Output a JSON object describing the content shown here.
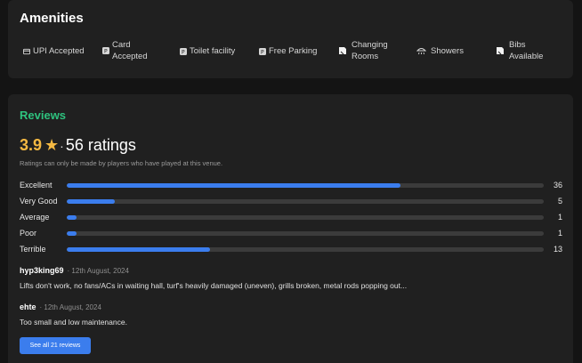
{
  "amenities": {
    "title": "Amenities",
    "items": [
      {
        "label_line1": "UPI Accepted",
        "label_line2": "",
        "icon": "upi-icon"
      },
      {
        "label_line1": "Card",
        "label_line2": "Accepted",
        "icon": "card-icon"
      },
      {
        "label_line1": "Toilet facility",
        "label_line2": "",
        "icon": "toilet-icon"
      },
      {
        "label_line1": "Free Parking",
        "label_line2": "",
        "icon": "parking-icon"
      },
      {
        "label_line1": "Changing",
        "label_line2": "Rooms",
        "icon": "changing-room-icon"
      },
      {
        "label_line1": "Showers",
        "label_line2": "",
        "icon": "shower-icon"
      },
      {
        "label_line1": "Bibs",
        "label_line2": "Available",
        "icon": "bibs-icon"
      }
    ]
  },
  "reviews": {
    "title": "Reviews",
    "score": "3.9",
    "star": "★",
    "separator": "·",
    "count_text": "56 ratings",
    "note": "Ratings can only be made by players who have played at this venue.",
    "distribution": [
      {
        "label": "Excellent",
        "count": "36",
        "fraction": 0.7
      },
      {
        "label": "Very Good",
        "count": "5",
        "fraction": 0.1
      },
      {
        "label": "Average",
        "count": "1",
        "fraction": 0.02
      },
      {
        "label": "Poor",
        "count": "1",
        "fraction": 0.02
      },
      {
        "label": "Terrible",
        "count": "13",
        "fraction": 0.3
      }
    ],
    "items": [
      {
        "user": "hyp3king69",
        "date": "· 12th August, 2024",
        "text": "Lifts don't work, no fans/ACs in waiting hall, turf's heavily damaged (uneven), grills broken, metal rods popping out..."
      },
      {
        "user": "ehte",
        "date": "· 12th August, 2024",
        "text": "Too small and low maintenance."
      }
    ],
    "see_all_label": "See all 21 reviews"
  },
  "colors": {
    "accent_blue": "#3b7ded",
    "review_green": "#2ec27e",
    "star_gold": "#f5b942"
  }
}
